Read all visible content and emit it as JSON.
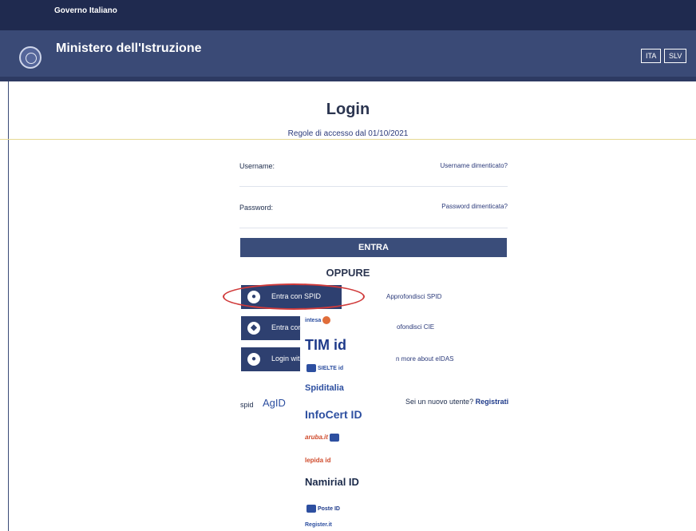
{
  "header": {
    "gov_label": "Governo Italiano",
    "ministry_title": "Ministero dell'Istruzione",
    "languages": [
      "ITA",
      "SLV"
    ]
  },
  "login": {
    "title": "Login",
    "access_rules": "Regole di accesso dal 01/10/2021",
    "username_label": "Username:",
    "username_forgot": "Username dimenticato?",
    "password_label": "Password:",
    "password_forgot": "Password dimenticata?",
    "enter_label": "ENTRA",
    "or_label": "OPPURE"
  },
  "auth": {
    "spid_label": "Entra con SPID",
    "cie_label": "Entra con",
    "eidas_label": "Login with",
    "spid_more": "Approfondisci SPID",
    "cie_more": "ofondisci CIE",
    "eidas_more": "n more about eIDAS"
  },
  "providers": {
    "intesa": "intesa",
    "tim": "TIM id",
    "sielte": "SIELTE id",
    "spiditalia": "Spiditalia",
    "infocert": "InfoCert ID",
    "aruba": "aruba.it",
    "lepida": "lepida id",
    "namirial": "Namirial ID",
    "poste": "Poste ID",
    "register": "Register.it"
  },
  "footer": {
    "spid_logo": "spid",
    "agid_logo": "AgID",
    "new_user": "Sei un nuovo utente?",
    "register_link": "Registrati"
  },
  "colors": {
    "header_top": "#1f2a4f",
    "header_main": "#3a4a76",
    "button": "#2e4070",
    "highlight": "#d03a3a"
  }
}
